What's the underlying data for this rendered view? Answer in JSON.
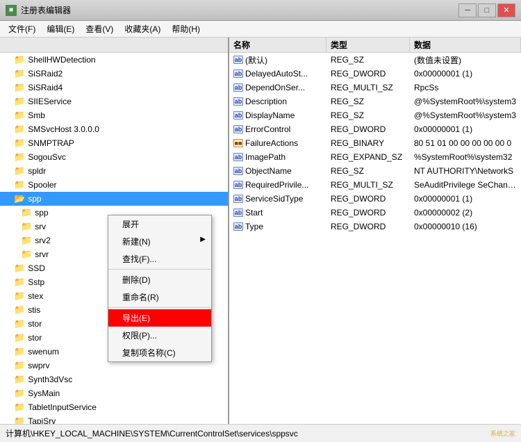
{
  "titleBar": {
    "title": "注册表编辑器",
    "minButton": "─",
    "maxButton": "□",
    "closeButton": "✕"
  },
  "menuBar": {
    "items": [
      "文件(F)",
      "编辑(E)",
      "查看(V)",
      "收藏夹(A)",
      "帮助(H)"
    ]
  },
  "treePanel": {
    "header": "",
    "items": [
      "ShellHWDetection",
      "SiSRaid2",
      "SiSRaid4",
      "SIIEService",
      "Smb",
      "SMSvcHost 3.0.0.0",
      "SNMPTRAP",
      "SogouSvc",
      "spldr",
      "Spooler",
      "spp",
      "spp",
      "srv",
      "srv2",
      "srvr",
      "SSD",
      "Sstp",
      "stex",
      "stis",
      "stor",
      "stor",
      "swenum",
      "swprv",
      "Synth3dVsc",
      "SysMain",
      "TabletInputService",
      "TapiSrv"
    ]
  },
  "selectedTreeItem": "spp",
  "contextMenu": {
    "items": [
      {
        "label": "展开",
        "type": "normal"
      },
      {
        "label": "新建(N)",
        "type": "submenu"
      },
      {
        "label": "查找(F)...",
        "type": "normal"
      },
      {
        "label": "separator1",
        "type": "separator"
      },
      {
        "label": "删除(D)",
        "type": "normal"
      },
      {
        "label": "重命名(R)",
        "type": "normal"
      },
      {
        "label": "separator2",
        "type": "separator"
      },
      {
        "label": "导出(E)",
        "type": "highlighted"
      },
      {
        "label": "权限(P)...",
        "type": "normal"
      },
      {
        "label": "复制项名称(C)",
        "type": "normal"
      }
    ]
  },
  "valuesPanel": {
    "headers": [
      "名称",
      "类型",
      "数据"
    ],
    "rows": [
      {
        "icon": "ab",
        "name": "(默认)",
        "type": "REG_SZ",
        "data": "(数值未设置)"
      },
      {
        "icon": "ab",
        "name": "DelayedAutoSt...",
        "type": "REG_DWORD",
        "data": "0x00000001 (1)"
      },
      {
        "icon": "ab",
        "name": "DependOnSer...",
        "type": "REG_MULTI_SZ",
        "data": "RpcSs"
      },
      {
        "icon": "ab",
        "name": "Description",
        "type": "REG_SZ",
        "data": "@%SystemRoot%\\system3"
      },
      {
        "icon": "ab",
        "name": "DisplayName",
        "type": "REG_SZ",
        "data": "@%SystemRoot%\\system3"
      },
      {
        "icon": "ab",
        "name": "ErrorControl",
        "type": "REG_DWORD",
        "data": "0x00000001 (1)"
      },
      {
        "icon": "bin",
        "name": "FailureActions",
        "type": "REG_BINARY",
        "data": "80 51 01 00 00 00 00 00 0"
      },
      {
        "icon": "ab",
        "name": "ImagePath",
        "type": "REG_EXPAND_SZ",
        "data": "%SystemRoot%\\system32"
      },
      {
        "icon": "ab",
        "name": "ObjectName",
        "type": "REG_SZ",
        "data": "NT AUTHORITY\\NetworkS"
      },
      {
        "icon": "ab",
        "name": "RequiredPrivile...",
        "type": "REG_MULTI_SZ",
        "data": "SeAuditPrivilege SeChange"
      },
      {
        "icon": "ab",
        "name": "ServiceSidType",
        "type": "REG_DWORD",
        "data": "0x00000001 (1)"
      },
      {
        "icon": "ab",
        "name": "Start",
        "type": "REG_DWORD",
        "data": "0x00000002 (2)"
      },
      {
        "icon": "ab",
        "name": "Type",
        "type": "REG_DWORD",
        "data": "0x00000010 (16)"
      }
    ]
  },
  "statusBar": {
    "text": "计算机\\HKEY_LOCAL_MACHINE\\SYSTEM\\CurrentControlSet\\services\\sppsvc"
  }
}
